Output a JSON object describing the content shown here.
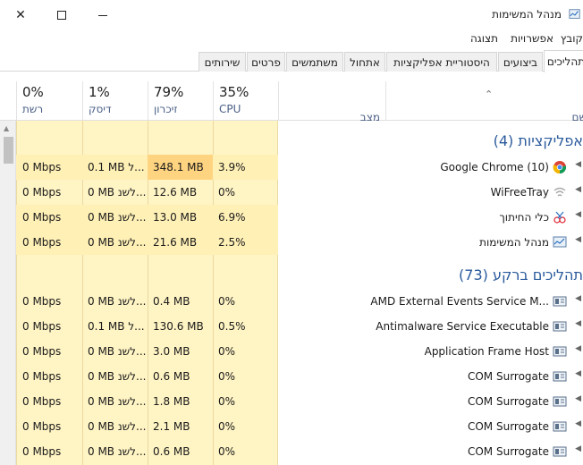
{
  "window": {
    "title": "מנהל המשימות",
    "controls": {
      "close": "✕",
      "maximize": "☐",
      "minimize": "—"
    }
  },
  "menu": [
    "קובץ",
    "אפשרויות",
    "תצוגה"
  ],
  "tabs": [
    {
      "label": "תהליכים",
      "active": true
    },
    {
      "label": "ביצועים"
    },
    {
      "label": "היסטוריית אפליקציות"
    },
    {
      "label": "אתחול"
    },
    {
      "label": "משתמשים"
    },
    {
      "label": "פרטים"
    },
    {
      "label": "שירותים"
    }
  ],
  "columns": {
    "name": "שם",
    "status": "מצב",
    "cpu": {
      "pct": "35%",
      "label": "CPU"
    },
    "memory": {
      "pct": "79%",
      "label": "זיכרון"
    },
    "disk": {
      "pct": "1%",
      "label": "דיסק"
    },
    "network": {
      "pct": "0%",
      "label": "רשת"
    }
  },
  "groups": {
    "apps": "אפליקציות (4)",
    "background": "תהליכים ברקע (73)"
  },
  "apps": [
    {
      "name": "Google Chrome (10)",
      "icon": "chrome-icon",
      "cpu": "3.9%",
      "memory": "348.1 MB",
      "disk": "0.1 MB ל...",
      "network": "0 Mbps"
    },
    {
      "name": "WiFreeTray",
      "icon": "wifi-icon",
      "cpu": "0%",
      "memory": "12.6 MB",
      "disk": "0 MB לשנ...",
      "network": "0 Mbps"
    },
    {
      "name": "כלי החיתוך",
      "icon": "snipping-tool-icon",
      "cpu": "6.9%",
      "memory": "13.0 MB",
      "disk": "0 MB לשנ...",
      "network": "0 Mbps"
    },
    {
      "name": "מנהל המשימות",
      "icon": "task-manager-icon",
      "cpu": "2.5%",
      "memory": "21.6 MB",
      "disk": "0 MB לשנ...",
      "network": "0 Mbps"
    }
  ],
  "background": [
    {
      "name": "AMD External Events Service M...",
      "icon": "service-icon",
      "cpu": "0%",
      "memory": "0.4 MB",
      "disk": "0 MB לשנ...",
      "network": "0 Mbps"
    },
    {
      "name": "Antimalware Service Executable",
      "icon": "service-icon",
      "cpu": "0.5%",
      "memory": "130.6 MB",
      "disk": "0.1 MB ל...",
      "network": "0 Mbps"
    },
    {
      "name": "Application Frame Host",
      "icon": "service-icon",
      "cpu": "0%",
      "memory": "3.0 MB",
      "disk": "0 MB לשנ...",
      "network": "0 Mbps"
    },
    {
      "name": "COM Surrogate",
      "icon": "service-icon",
      "cpu": "0%",
      "memory": "0.6 MB",
      "disk": "0 MB לשנ...",
      "network": "0 Mbps"
    },
    {
      "name": "COM Surrogate",
      "icon": "service-icon",
      "cpu": "0%",
      "memory": "1.8 MB",
      "disk": "0 MB לשנ...",
      "network": "0 Mbps"
    },
    {
      "name": "COM Surrogate",
      "icon": "service-icon",
      "cpu": "0%",
      "memory": "2.1 MB",
      "disk": "0 MB לשנ...",
      "network": "0 Mbps"
    },
    {
      "name": "COM Surrogate",
      "icon": "service-icon",
      "cpu": "0%",
      "memory": "0.6 MB",
      "disk": "0 MB לשנ...",
      "network": "0 Mbps"
    }
  ],
  "colors": {
    "heat_low": "#fff4c4",
    "heat_mid": "#fff0b6",
    "heat_high": "#ffd480",
    "group_text": "#2a5a9c",
    "header_label": "#4a5f86"
  }
}
